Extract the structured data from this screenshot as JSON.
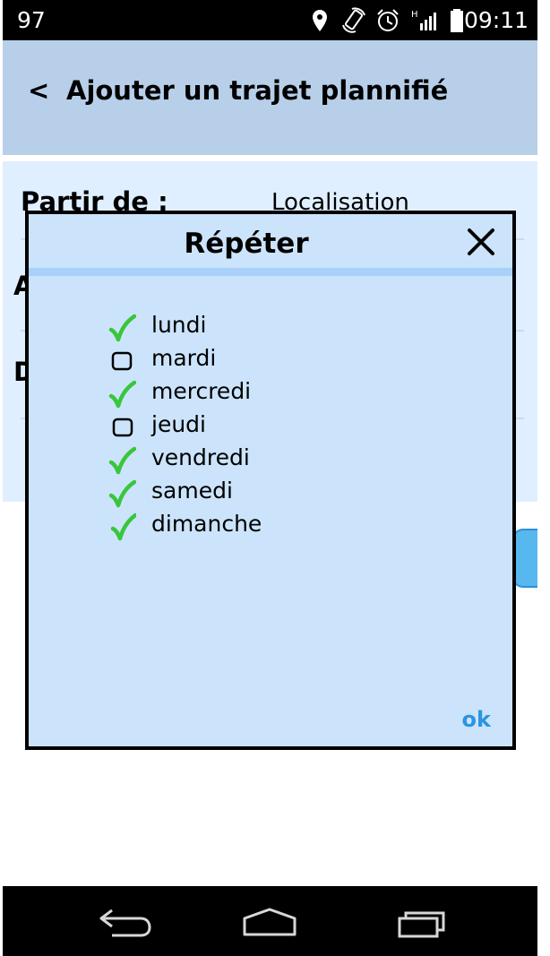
{
  "status_bar": {
    "left_text": "97",
    "time": "09:11",
    "icons": [
      "location-icon",
      "rotate-icon",
      "alarm-icon",
      "signal-icon",
      "battery-icon"
    ]
  },
  "header": {
    "back_label": "<",
    "title": "Ajouter un trajet plannifié"
  },
  "form": {
    "from_label": "Partir de :",
    "from_value": "Localisation",
    "hidden_fragment_1": "A",
    "hidden_fragment_2": "D"
  },
  "dialog": {
    "title": "Répéter",
    "ok_label": "ok",
    "days": [
      {
        "label": "lundi",
        "checked": true
      },
      {
        "label": "mardi",
        "checked": false
      },
      {
        "label": "mercredi",
        "checked": true
      },
      {
        "label": "jeudi",
        "checked": false
      },
      {
        "label": "vendredi",
        "checked": true
      },
      {
        "label": "samedi",
        "checked": true
      },
      {
        "label": "dimanche",
        "checked": true
      }
    ]
  },
  "nav_bar": {
    "icons": [
      "back-icon",
      "home-icon",
      "recent-apps-icon"
    ]
  },
  "colors": {
    "status_bar": "#000000",
    "header": "#b7cfe9",
    "form_background": "#e0efff",
    "dialog_background": "#cce4fb",
    "dialog_band": "#a8d0f8",
    "check": "#39c63b",
    "ok_text": "#2d94e0"
  }
}
